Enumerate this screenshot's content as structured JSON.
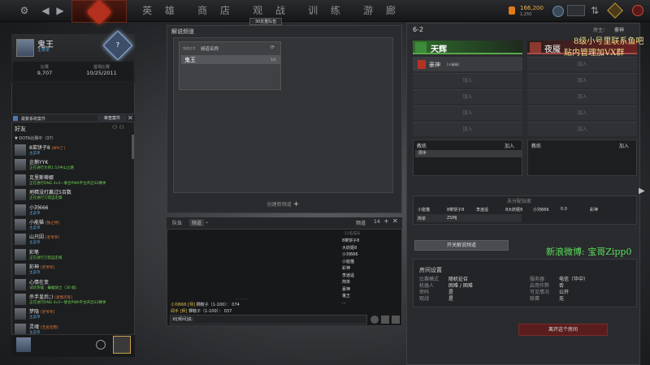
{
  "topbar": {
    "nav": [
      "英 雄",
      "商 店",
      "观 战",
      "训 练",
      "游 廊"
    ],
    "party_badge": "30支重队伍",
    "gold": "166,200",
    "gold_sub": "1,250",
    "icons": [
      "gear-icon",
      "back-icon",
      "dota-logo-icon",
      "trophy-icon",
      "chat-icon",
      "shop-icon",
      "power-icon"
    ]
  },
  "profile": {
    "name": "鬼王",
    "subtitle": "主菜单",
    "rank_symbol": "?",
    "stats": [
      {
        "label": "比赛",
        "value": "9,707"
      },
      {
        "label": "首场比赛",
        "value": "10/25/2011"
      }
    ]
  },
  "notice": {
    "text": "最繁系统案件",
    "button": "审查案件",
    "close": "✕"
  },
  "friends": {
    "heading": "好友",
    "group": "▼ DOTA比赛中（37）",
    "items": [
      {
        "name": "8菜饼子8",
        "tag": "[8PA了]",
        "status": "主菜单",
        "green": false
      },
      {
        "name": "企鹅YYK",
        "tag": "",
        "status": "正在进行大师1.52中山之路",
        "green": true
      },
      {
        "name": "克里斯蒂娜",
        "tag": "",
        "status": "正在进行DNG 4v3—联合PWA平台开启S2赛季",
        "green": true
      },
      {
        "name": "地精没打赢过5百数",
        "tag": "",
        "status": "正在进行刀塔自走棋",
        "green": true
      },
      {
        "name": "小刘666",
        "tag": "",
        "status": "主菜单",
        "green": false
      },
      {
        "name": "小能猫",
        "tag": "[独之侍]",
        "status": "主菜单",
        "green": false
      },
      {
        "name": "山只因",
        "tag": "[老爷爷]",
        "status": "主菜单",
        "green": false
      },
      {
        "name": "彩笔",
        "tag": "",
        "status": "正在进行刀塔自走棋",
        "green": true
      },
      {
        "name": "彩神",
        "tag": "[老爷爷]",
        "status": "主菜单",
        "green": false
      },
      {
        "name": "心情在变",
        "tag": "",
        "status": "试玩英雄：蝙蝠骑士（30 级）",
        "green": true
      },
      {
        "name": "杀手皇后；)",
        "tag": "[爱情次等]",
        "status": "正在进行DNG 4v3—联合PWA平台开启S2赛季",
        "green": true
      },
      {
        "name": "梦隐",
        "tag": "[老爷爷]",
        "status": "主菜单",
        "green": false
      },
      {
        "name": "灵魂",
        "tag": "[无名玩用]",
        "status": "主菜单",
        "green": false
      }
    ]
  },
  "lobby_browser": {
    "title": "解说频道",
    "col_filter": "频道名字",
    "col_name": "频道名称",
    "row_name": "鬼王",
    "row_count": "1/4",
    "create": "创建新频道"
  },
  "chat": {
    "tabs": [
      "队伍",
      "频道"
    ],
    "members_label": "频道",
    "members_count": "14",
    "members_header": "11名成员",
    "members": [
      "8菜饼子8",
      "大妖姬8",
      "小刘666",
      "小能猫",
      "彩神",
      "李逍遥",
      "简单",
      "豪神",
      "鬼王",
      "..."
    ],
    "messages": [
      {
        "who": "小刘666 [师]",
        "who2": "狮鞍子（1-100）：",
        "text": "074"
      },
      {
        "who": "阎手 [师]",
        "who2": "狮鞍子（1-100）：",
        "text": "037"
      }
    ],
    "input_prefix": "对[频间]说：",
    "close": "✕",
    "add": "+"
  },
  "room": {
    "id": "6-2",
    "host_label": "房主：",
    "host": "豪神",
    "radiant": "天辉",
    "dire": "夜魇",
    "radiant_player": "豪神",
    "radiant_tag": "[小精精]",
    "join": "加入",
    "coach": "教练",
    "coach_player": "周手",
    "unassigned_title": "未分配玩家",
    "unassigned": [
      "小能猫",
      "8菜饼子8",
      "李逍遥",
      "8大妖姬8",
      "小刘666",
      "0.0",
      "彩神"
    ],
    "unassigned2": [
      "简单",
      "ZSMJ"
    ],
    "open_channel": "开关解说频道",
    "settings_title": "房间设置",
    "settings": [
      {
        "k": "比赛模式",
        "v": "随机征召"
      },
      {
        "k": "机器人",
        "v": "困难 / 困难"
      },
      {
        "k": "密码",
        "v": "是"
      },
      {
        "k": "观战",
        "v": "是"
      }
    ],
    "settings2": [
      {
        "k": "服务器",
        "v": "电信（华中）"
      },
      {
        "k": "启用作弊",
        "v": "否"
      },
      {
        "k": "可见情况",
        "v": "公开"
      },
      {
        "k": "联赛",
        "v": "无"
      }
    ],
    "leave": "离开这个房间"
  },
  "overlay": {
    "line1": "8级小号里联系鱼吧",
    "line2": "贴内管理加VX群",
    "line3": "新浪微博: 宝哥Zipp0"
  }
}
